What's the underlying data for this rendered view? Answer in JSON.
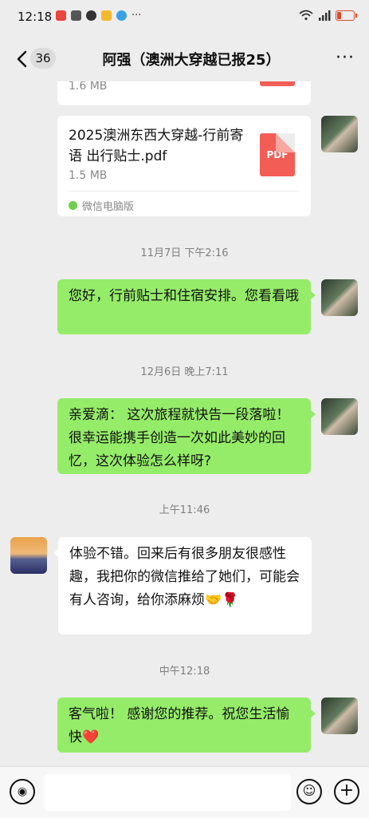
{
  "status_bar": {
    "time": "12:18",
    "more": "···"
  },
  "header": {
    "unread_count": "36",
    "title": "阿强（澳洲大穿越已报25）",
    "more": "···"
  },
  "messages": {
    "file1": {
      "size": "1.6 MB"
    },
    "file2": {
      "name": "2025澳洲东西大穿越-行前寄语 出行贴士.pdf",
      "size": "1.5 MB",
      "icon_text": "PDF",
      "source": "微信电脑版"
    },
    "time1": "11月7日 下午2:16",
    "msg1": "您好，行前贴士和住宿安排。您看看哦",
    "time2": "12月6日 晚上7:11",
    "msg2": "亲爱滴： 这次旅程就快告一段落啦！很幸运能携手创造一次如此美妙的回忆，这次体验怎么样呀?",
    "time3": "上午11:46",
    "msg3": "体验不错。回来后有很多朋友很感性趣，我把你的微信推给了她们，可能会有人咨询，给你添麻烦🤝🌹",
    "time4": "中午12:18",
    "msg4": "客气啦！ 感谢您的推荐。祝您生活愉快❤️"
  },
  "input_bar": {
    "voice_glyph": "◉",
    "emoji_glyph": "☺",
    "plus_glyph": "+"
  },
  "colors": {
    "bubble_green": "#95ec69",
    "background": "#ededed",
    "pdf_red": "#f25d56"
  }
}
